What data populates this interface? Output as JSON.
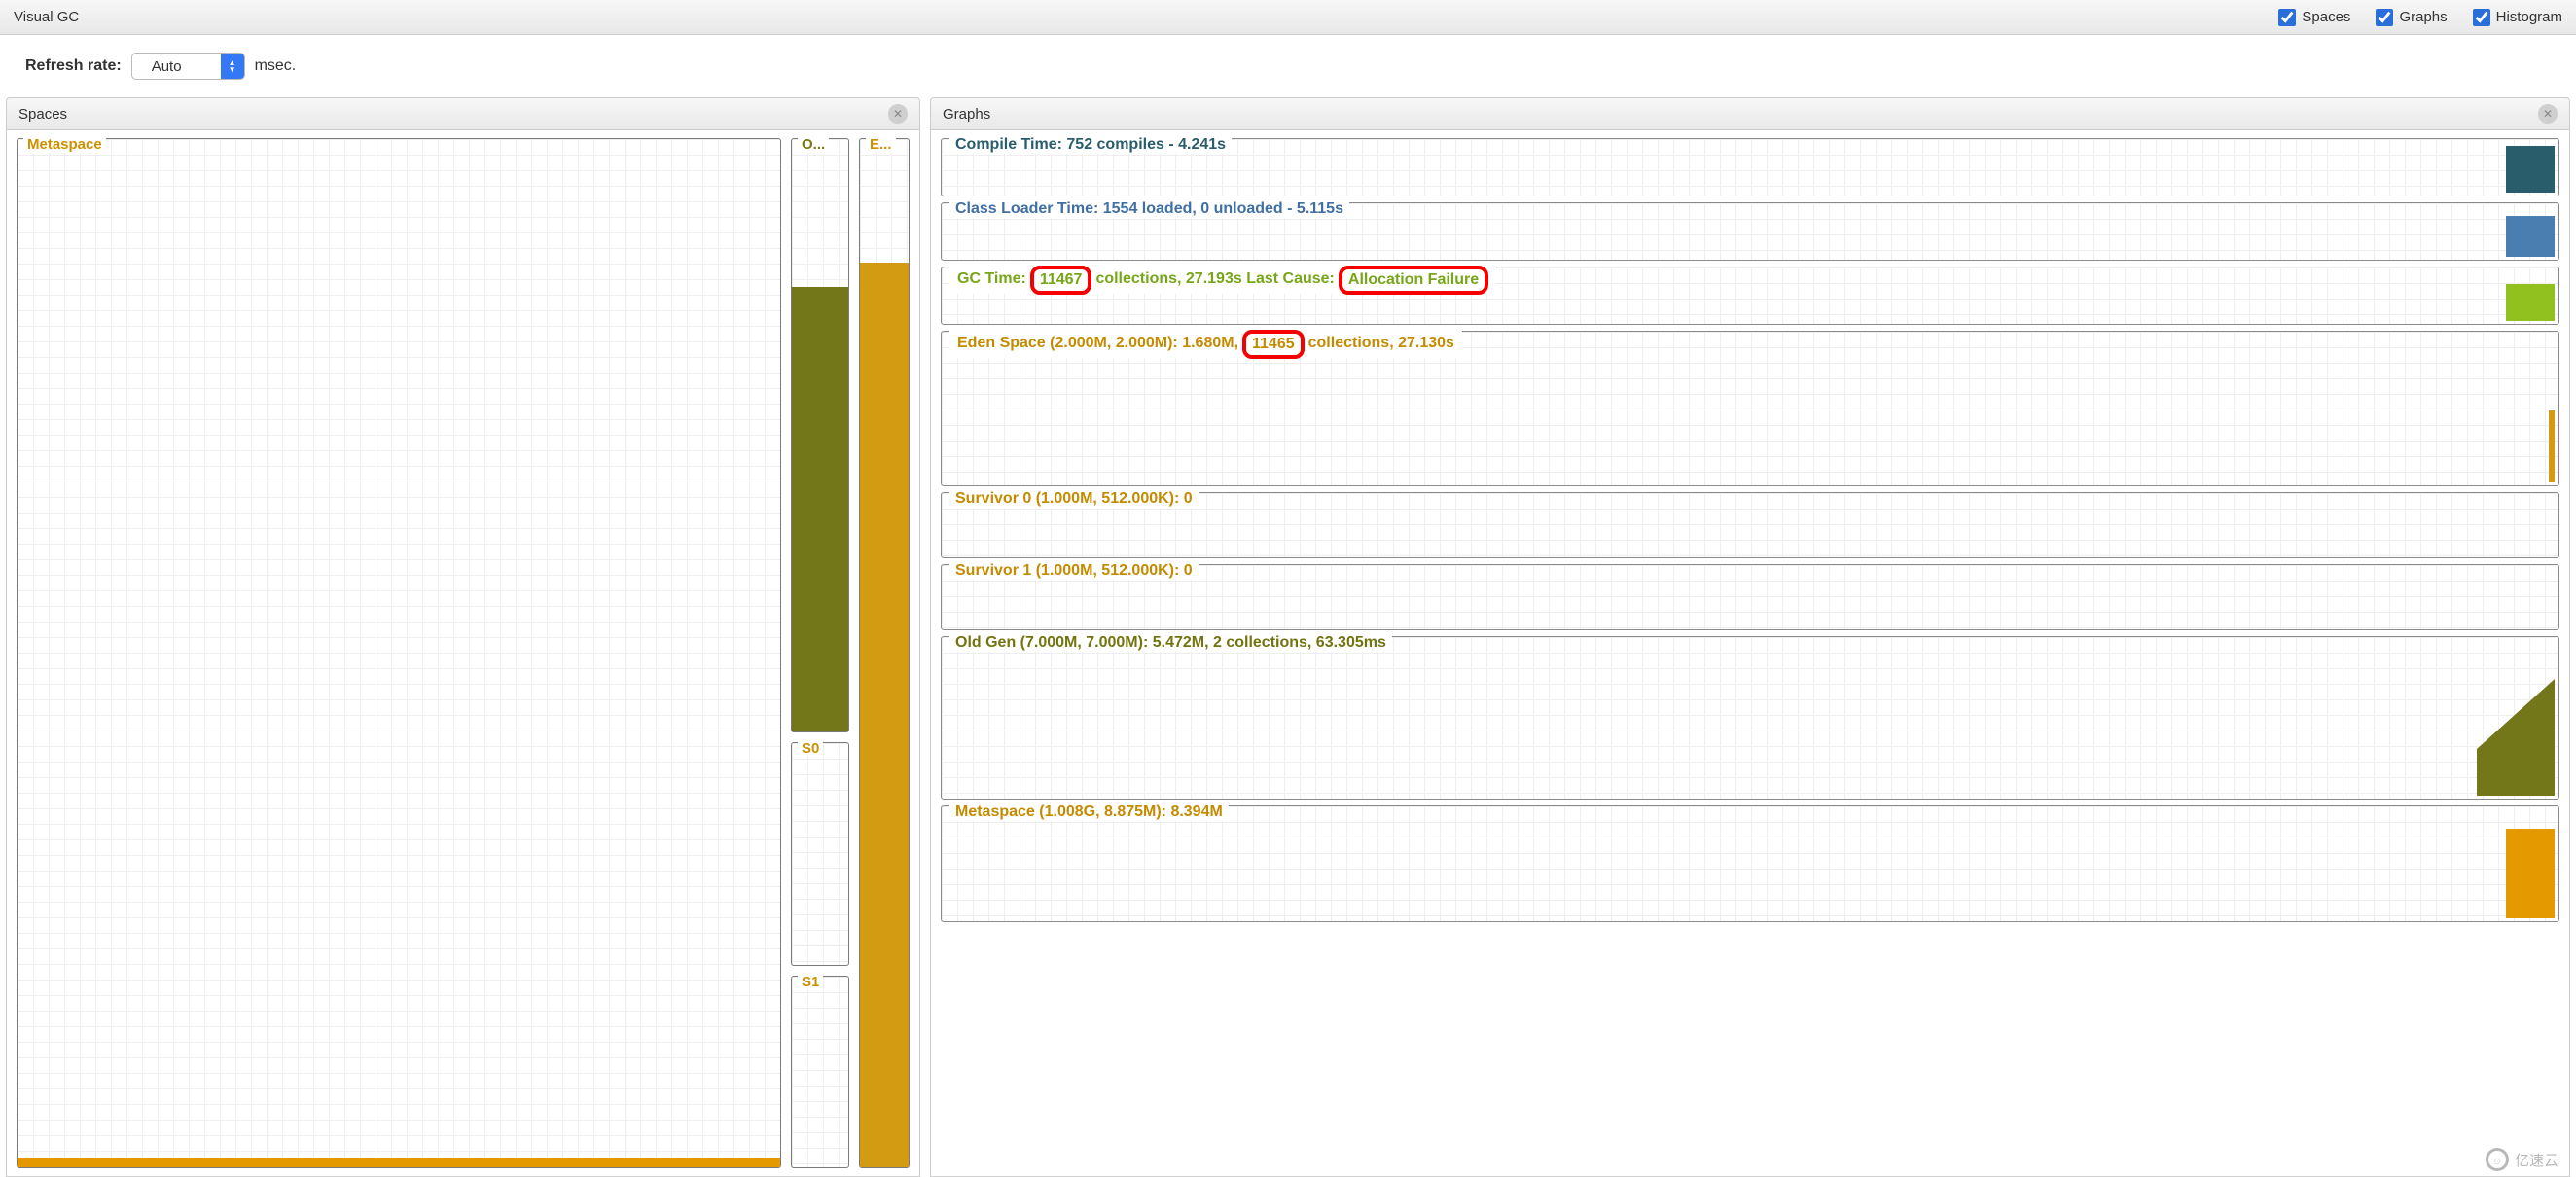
{
  "header": {
    "title": "Visual GC",
    "checks": {
      "spaces": "Spaces",
      "graphs": "Graphs",
      "histogram": "Histogram"
    }
  },
  "refresh": {
    "label": "Refresh rate:",
    "value": "Auto",
    "unit": "msec."
  },
  "panels": {
    "spaces": {
      "title": "Spaces"
    },
    "graphs": {
      "title": "Graphs"
    }
  },
  "spaces": {
    "metaspace_label": "Metaspace",
    "o_label": "O...",
    "e_label": "E...",
    "s0_label": "S0",
    "s1_label": "S1"
  },
  "graphs": {
    "compile": {
      "label": "Compile Time: 752 compiles - 4.241s"
    },
    "loader": {
      "label": "Class Loader Time: 1554 loaded, 0 unloaded - 5.115s"
    },
    "gc": {
      "pre": "GC Time:",
      "collections": "11467",
      "mid": "collections, 27.193s  Last Cause:",
      "cause": "Allocation Failure"
    },
    "eden": {
      "pre": "Eden Space (2.000M, 2.000M): 1.680M,",
      "collections": "11465",
      "post": "collections, 27.130s"
    },
    "surv0": {
      "label": "Survivor 0 (1.000M, 512.000K): 0"
    },
    "surv1": {
      "label": "Survivor 1 (1.000M, 512.000K): 0"
    },
    "oldgen": {
      "label": "Old Gen (7.000M, 7.000M): 5.472M, 2 collections, 63.305ms"
    },
    "metaspace": {
      "label": "Metaspace (1.008G, 8.875M): 8.394M"
    }
  },
  "chart_data": [
    {
      "type": "bar",
      "name": "Metaspace",
      "capacity": "1.008G",
      "committed": "8.875M",
      "used": "8.394M",
      "fill_pct": 1
    },
    {
      "type": "bar",
      "name": "Old Gen",
      "capacity": "7.000M",
      "committed": "7.000M",
      "used": "5.472M",
      "fill_pct": 78,
      "collections": 2,
      "time": "63.305ms"
    },
    {
      "type": "bar",
      "name": "Eden",
      "capacity": "2.000M",
      "committed": "2.000M",
      "used": "1.680M",
      "fill_pct": 84,
      "collections": 11465,
      "time": "27.130s"
    },
    {
      "type": "bar",
      "name": "Survivor 0",
      "capacity": "1.000M",
      "committed": "512.000K",
      "used": 0,
      "fill_pct": 0
    },
    {
      "type": "bar",
      "name": "Survivor 1",
      "capacity": "1.000M",
      "committed": "512.000K",
      "used": 0,
      "fill_pct": 0
    },
    {
      "type": "line",
      "name": "Compile Time",
      "compiles": 752,
      "time": "4.241s"
    },
    {
      "type": "line",
      "name": "Class Loader Time",
      "loaded": 1554,
      "unloaded": 0,
      "time": "5.115s"
    },
    {
      "type": "line",
      "name": "GC Time",
      "collections": 11467,
      "time": "27.193s",
      "last_cause": "Allocation Failure"
    }
  ],
  "watermark": "亿速云"
}
